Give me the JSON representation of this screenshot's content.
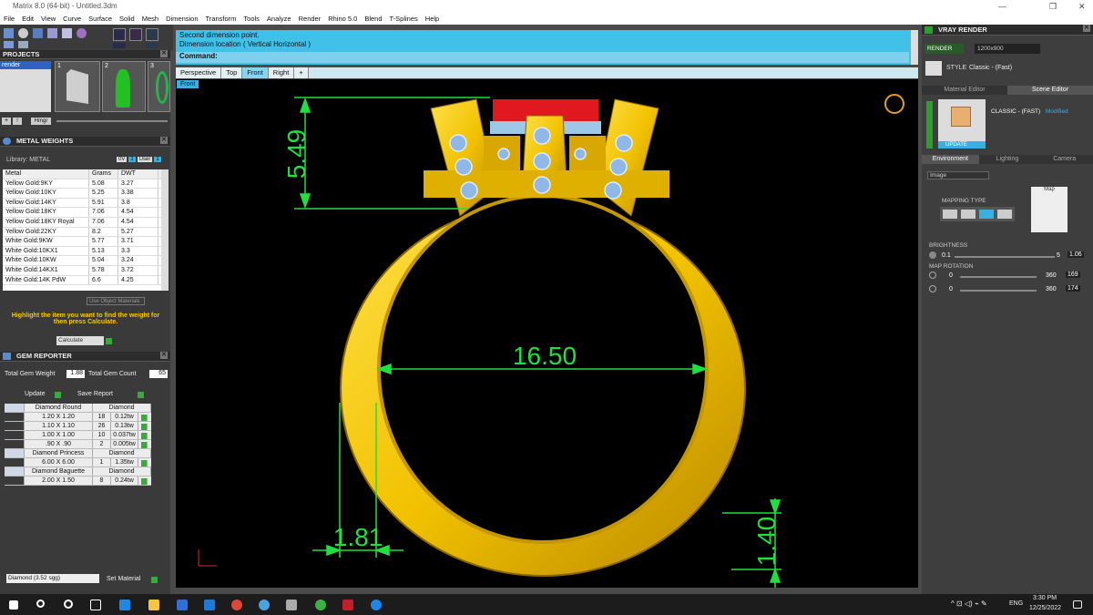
{
  "window": {
    "title": "Matrix 8.0 (64-bit) - Untitled.3dm"
  },
  "menu": [
    "File",
    "Edit",
    "View",
    "Curve",
    "Surface",
    "Solid",
    "Mesh",
    "Dimension",
    "Transform",
    "Tools",
    "Analyze",
    "Render",
    "Rhino 5.0",
    "Blend",
    "T-Splines",
    "Help"
  ],
  "projects": {
    "title": "PROJECTS",
    "item": "render",
    "thumbs": [
      "1",
      "2",
      "3"
    ],
    "layer_btn": "Hmgr"
  },
  "metal": {
    "title": "METAL WEIGHTS",
    "library_label": "Library: METAL",
    "flags": [
      "0V",
      "1",
      "User",
      "1"
    ],
    "headers": [
      "Metal",
      "Grams",
      "DWT"
    ],
    "rows": [
      [
        "Yellow Gold:9KY",
        "5.08",
        "3.27"
      ],
      [
        "Yellow Gold:10KY",
        "5.25",
        "3.38"
      ],
      [
        "Yellow Gold:14KY",
        "5.91",
        "3.8"
      ],
      [
        "Yellow Gold:18KY",
        "7.06",
        "4.54"
      ],
      [
        "Yellow Gold:18KY Royal",
        "7.06",
        "4.54"
      ],
      [
        "Yellow Gold:22KY",
        "8.2",
        "5.27"
      ],
      [
        "White Gold:9KW",
        "5.77",
        "3.71"
      ],
      [
        "White Gold:10KX1",
        "5.13",
        "3.3"
      ],
      [
        "White Gold:10KW",
        "5.04",
        "3.24"
      ],
      [
        "White Gold:14KX1",
        "5.78",
        "3.72"
      ],
      [
        "White Gold:14K PdW",
        "6.6",
        "4.25"
      ]
    ],
    "use_object": "Use Object Materials",
    "hint": "Highlight the item you want to find the weight for then press Calculate.",
    "calc": "Calculate"
  },
  "gem": {
    "title": "GEM REPORTER",
    "total_weight_label": "Total Gem Weight",
    "total_weight": "1.88",
    "total_count_label": "Total Gem Count",
    "total_count": "65",
    "update": "Update",
    "save": "Save Report",
    "groups": [
      {
        "name": "Diamond Round",
        "type": "Diamond",
        "rows": [
          [
            "1.20 X 1.20",
            "18",
            "0.12tw"
          ],
          [
            "1.10 X 1.10",
            "26",
            "0.13tw"
          ],
          [
            "1.00 X 1.00",
            "10",
            "0.037tw"
          ],
          [
            ".90 X .90",
            "2",
            "0.005tw"
          ]
        ]
      },
      {
        "name": "Diamond Princess",
        "type": "Diamond",
        "rows": [
          [
            "6.00 X 6.00",
            "1",
            "1.35tw"
          ]
        ]
      },
      {
        "name": "Diamond Baguette",
        "type": "Diamond",
        "rows": [
          [
            "2.00 X 1.50",
            "8",
            "0.24tw"
          ]
        ]
      }
    ],
    "material_select": "Diamond   (3.52 sgg)",
    "set_material": "Set Material"
  },
  "command": {
    "line1": "Second dimension point.",
    "line2": "Dimension location ( Vertical  Horizontal )",
    "prompt": "Command:"
  },
  "view_tabs": [
    "Perspective",
    "Top",
    "Front",
    "Right",
    "+"
  ],
  "view_label": "Front",
  "dims": {
    "top": "5.49",
    "inner": "16.50",
    "shank": "1.81",
    "bottom": "1.40"
  },
  "vray": {
    "title": "VRAY RENDER",
    "render_btn": "RENDER",
    "resolution": "1200x900",
    "style_label": "STYLE",
    "style_value": "Classic - (Fast)",
    "tabs": [
      "Material Editor",
      "Scene Editor"
    ],
    "preset": "CLASSIC - (FAST)",
    "modified": "Modified",
    "update": "UPDATE",
    "env_tabs": [
      "Environment",
      "Lighting",
      "Camera"
    ],
    "image_select": "Image",
    "mapping": "MAPPING TYPE",
    "map": "Map",
    "brightness": "BRIGHTNESS",
    "b_min": "0.1",
    "b_max": "5",
    "b_val": "1.06",
    "rotation": "MAP ROTATION",
    "r_min": "0",
    "r_max": "360",
    "r1": "169",
    "r2": "174"
  },
  "taskbar": {
    "lang": "ENG",
    "time": "3:30 PM",
    "date": "12/25/2022"
  }
}
